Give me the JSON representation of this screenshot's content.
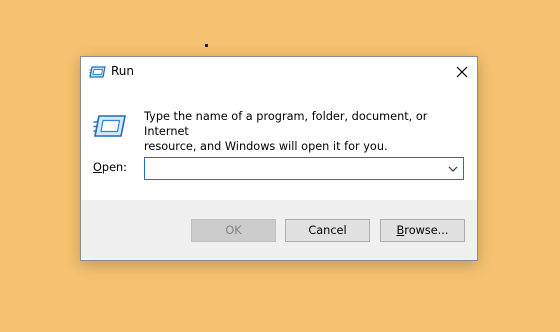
{
  "window": {
    "title": "Run",
    "close_icon": "close-icon"
  },
  "content": {
    "description_line1": "Type the name of a program, folder, document, or Internet",
    "description_line2": "resource, and Windows will open it for you.",
    "open_label_accel": "O",
    "open_label_rest": "pen:",
    "open_value": "",
    "dropdown_icon": "chevron-down-icon",
    "run_icon": "run-icon"
  },
  "buttons": {
    "ok": "OK",
    "cancel": "Cancel",
    "browse_accel": "B",
    "browse_rest": "rowse..."
  },
  "colors": {
    "desktop": "#F6C271",
    "footer": "#F0F0F0",
    "input_border": "#1A73C9",
    "button_bg": "#E1E1E1",
    "disabled_button_bg": "#CCCCCC"
  }
}
